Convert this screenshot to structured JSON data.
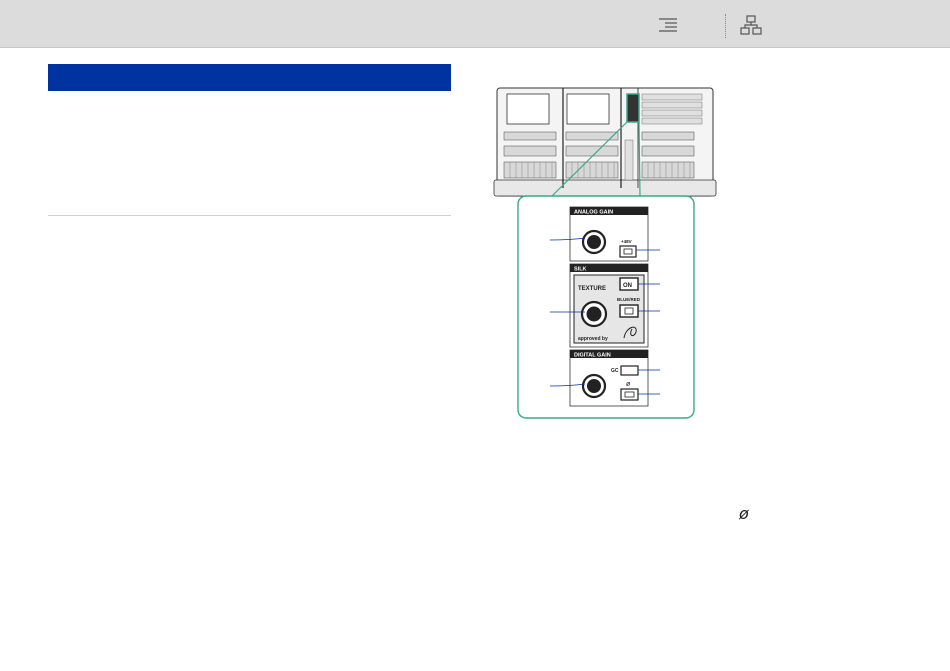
{
  "toolbar": {
    "toc_icon": "list-indent-icon",
    "map_icon": "sitemap-icon"
  },
  "section": {
    "header_color": "#0033a0"
  },
  "figure": {
    "frame_color": "#3aa88a",
    "panels": {
      "analog_gain": {
        "title": "ANALOG GAIN",
        "phantom_label": "+48V"
      },
      "silk": {
        "title": "SILK",
        "texture_label": "TEXTURE",
        "on_label": "ON",
        "blue_red_label": "BLUE/RED",
        "approved_label": "approved by"
      },
      "digital_gain": {
        "title": "DIGITAL GAIN",
        "gc_label": "GC",
        "phase_label": "ø"
      }
    }
  },
  "phase_symbol": "ø"
}
